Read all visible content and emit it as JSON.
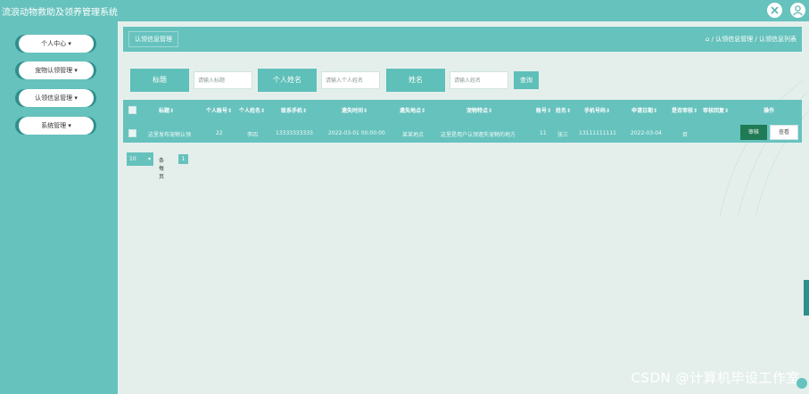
{
  "app": {
    "title": "流浪动物救助及领养管理系统"
  },
  "topbar": {
    "fullscreen_icon": "expand-icon",
    "user_icon": "user-icon"
  },
  "sidebar": {
    "items": [
      {
        "label": "个人中心",
        "icon": "chevron-down-icon"
      },
      {
        "label": "宠物认领管理",
        "icon": "chevron-down-icon"
      },
      {
        "label": "认领信息管理",
        "icon": "chevron-down-icon"
      },
      {
        "label": "系统管理",
        "icon": "chevron-down-icon"
      }
    ]
  },
  "breadcrumb": {
    "tag": "认领信息管理",
    "home_icon": "home-icon",
    "path": "/ 认领信息管理 / 认领信息列表"
  },
  "search": {
    "fields": [
      {
        "label": "标题",
        "placeholder": "请输入标题"
      },
      {
        "label": "个人姓名",
        "placeholder": "请输入个人姓名"
      },
      {
        "label": "姓名",
        "placeholder": "请输入姓名"
      }
    ],
    "button": "查询"
  },
  "table": {
    "columns": [
      "标题",
      "个人账号",
      "个人姓名",
      "联系手机",
      "遗失时间",
      "遗失地点",
      "宠物特点",
      "账号",
      "姓名",
      "手机号码",
      "申请日期",
      "是否审核",
      "审核回复",
      "操作"
    ],
    "rows": [
      {
        "title": "这里发布宠物认领",
        "account": "22",
        "name": "李四",
        "phone": "13333333333",
        "lost_time": "2022-03-01 00:00:00",
        "lost_place": "某某地点",
        "feature": "这里是用户认领遗失宠物的地方",
        "acct2": "11",
        "name2": "张三",
        "phone2": "13111111111",
        "apply_date": "2022-03-04",
        "reviewed": "否",
        "reply": "",
        "actions": [
          "审核",
          "查看"
        ]
      }
    ]
  },
  "pagination": {
    "page_size": "10",
    "page_size_unit": "条每页",
    "current_page": "1"
  },
  "watermark": "CSDN @计算机毕设工作室",
  "colors": {
    "primary": "#66c2bd",
    "dark": "#2f8f8b",
    "background": "#e4efec",
    "audit_button": "#1f7a55"
  }
}
